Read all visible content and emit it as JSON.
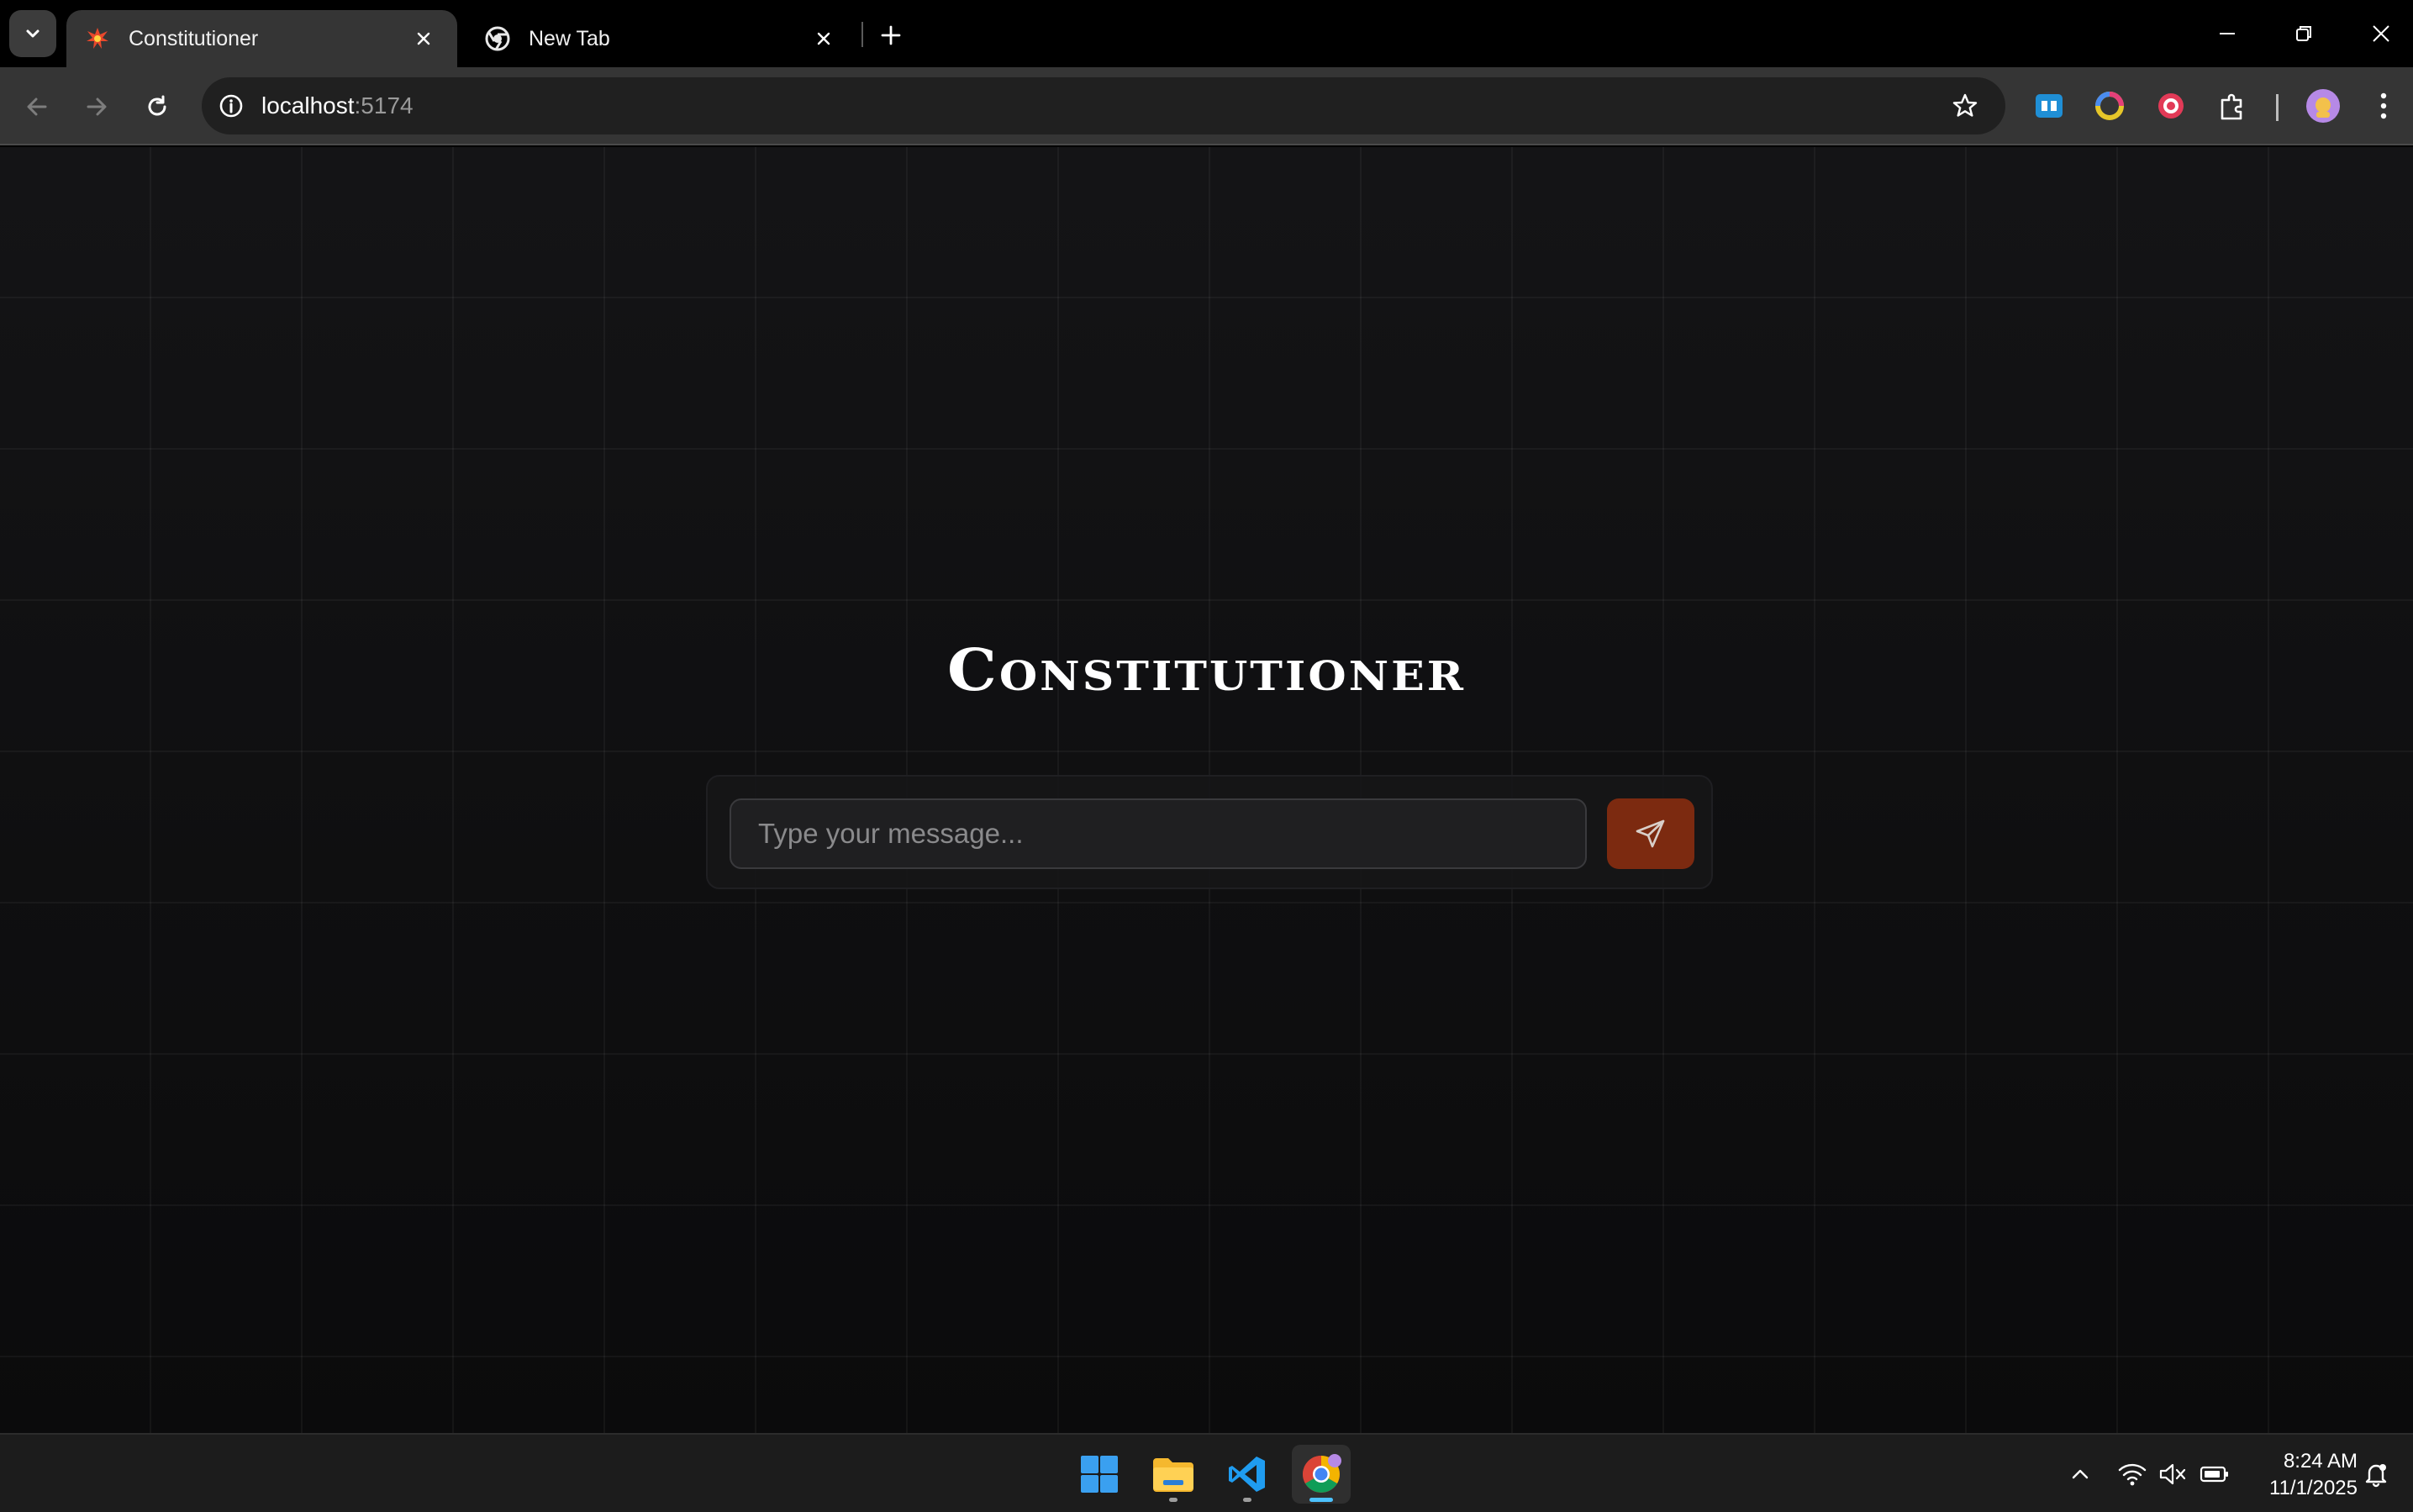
{
  "browser": {
    "tabs": [
      {
        "title": "Constitutioner",
        "active": true,
        "favicon": "starburst-favicon-icon"
      },
      {
        "title": "New Tab",
        "active": false,
        "favicon": "chrome-icon"
      }
    ],
    "address": {
      "host": "localhost",
      "port": ":5174"
    }
  },
  "page": {
    "title": "Constitutioner",
    "input_placeholder": "Type your message...",
    "accent_color": "#7c2a10",
    "background_color": "#0e0e10"
  },
  "taskbar": {
    "apps": [
      "windows-start-icon",
      "file-explorer-icon",
      "vscode-icon",
      "chrome-icon"
    ],
    "time": "8:24 AM",
    "date": "11/1/2025"
  }
}
